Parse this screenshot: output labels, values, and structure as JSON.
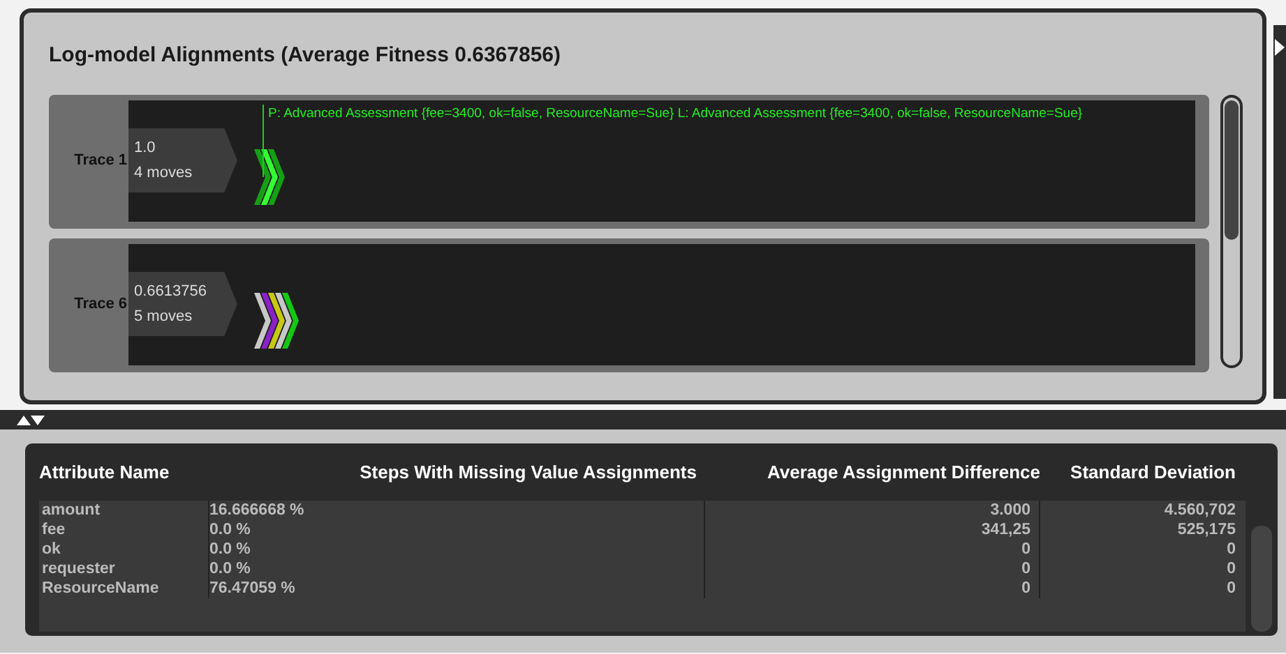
{
  "alignments": {
    "title": "Log-model Alignments (Average Fitness 0.6367856)",
    "traces": [
      {
        "name": "Trace 1",
        "fitness": "1.0",
        "moves_count": "4 moves",
        "move_label": "P: Advanced Assessment {fee=3400, ok=false, ResourceName=Sue}  L: Advanced Assessment {fee=3400, ok=false, ResourceName=Sue}",
        "moves": [
          {
            "color": "#14a014"
          },
          {
            "color": "#33ff33"
          },
          {
            "color": "#14a014"
          }
        ]
      },
      {
        "name": "Trace 6",
        "fitness": "0.6613756",
        "moves_count": "5 moves",
        "moves": [
          {
            "color": "#c8c8c8"
          },
          {
            "color": "#8a22c8"
          },
          {
            "color": "#c8c814"
          },
          {
            "color": "#c8c8c8"
          },
          {
            "color": "#14c814"
          }
        ]
      }
    ]
  },
  "attributes": {
    "columns": [
      "Attribute Name",
      "Steps With Missing Value Assignments",
      "Average Assignment Difference",
      "Standard Deviation"
    ],
    "rows": [
      [
        "amount",
        "16.666668 %",
        "3.000",
        "4.560,702"
      ],
      [
        "fee",
        "0.0 %",
        "341,25",
        "525,175"
      ],
      [
        "ok",
        "0.0 %",
        "0",
        "0"
      ],
      [
        "requester",
        "0.0 %",
        "0",
        "0"
      ],
      [
        "ResourceName",
        "76.47059 %",
        "0",
        "0"
      ]
    ]
  }
}
